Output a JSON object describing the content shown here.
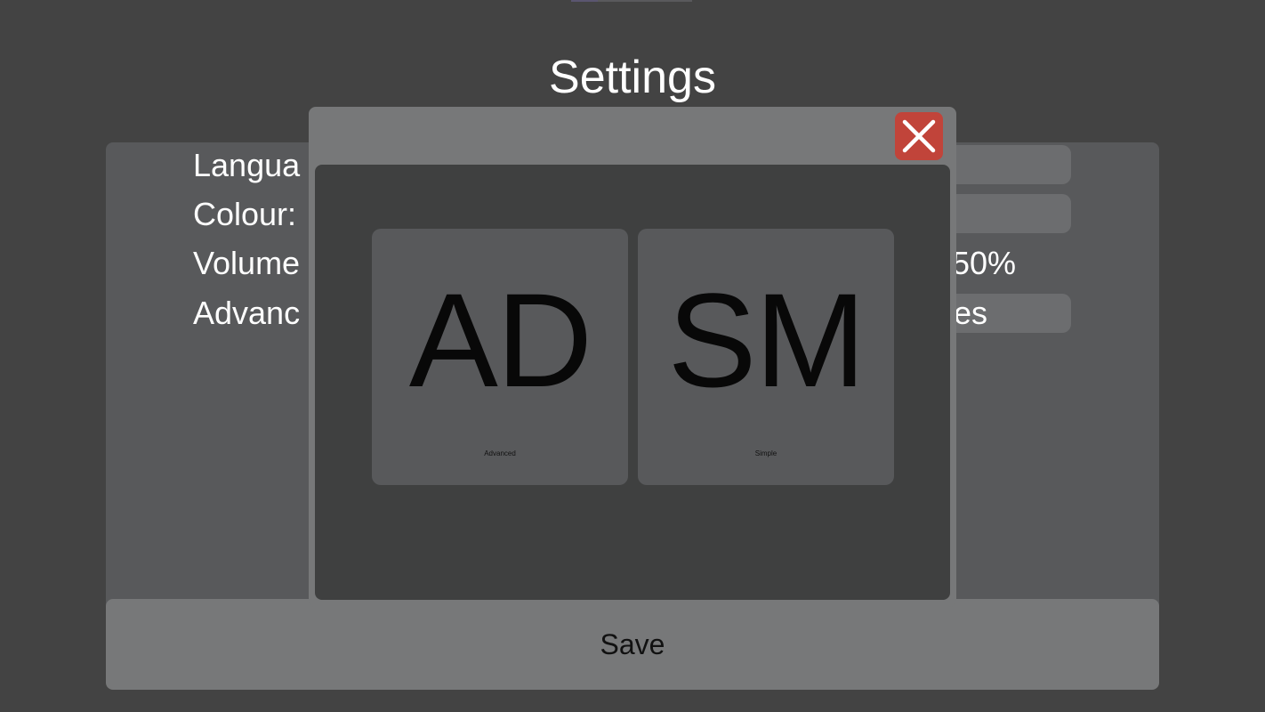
{
  "page": {
    "title": "Settings",
    "background_color": "#434343"
  },
  "settings": {
    "rows": [
      {
        "label": "Langua",
        "value": ""
      },
      {
        "label": "Colour:",
        "value": ""
      },
      {
        "label": "Volume",
        "value": "50%"
      },
      {
        "label": "Advanc",
        "value": "es"
      }
    ],
    "save_label": "Save"
  },
  "modal": {
    "close_icon": "close-icon",
    "close_color": "#c1443a",
    "options": [
      {
        "abbr": "AD",
        "caption": "Advanced"
      },
      {
        "abbr": "SM",
        "caption": "Simple"
      }
    ]
  }
}
